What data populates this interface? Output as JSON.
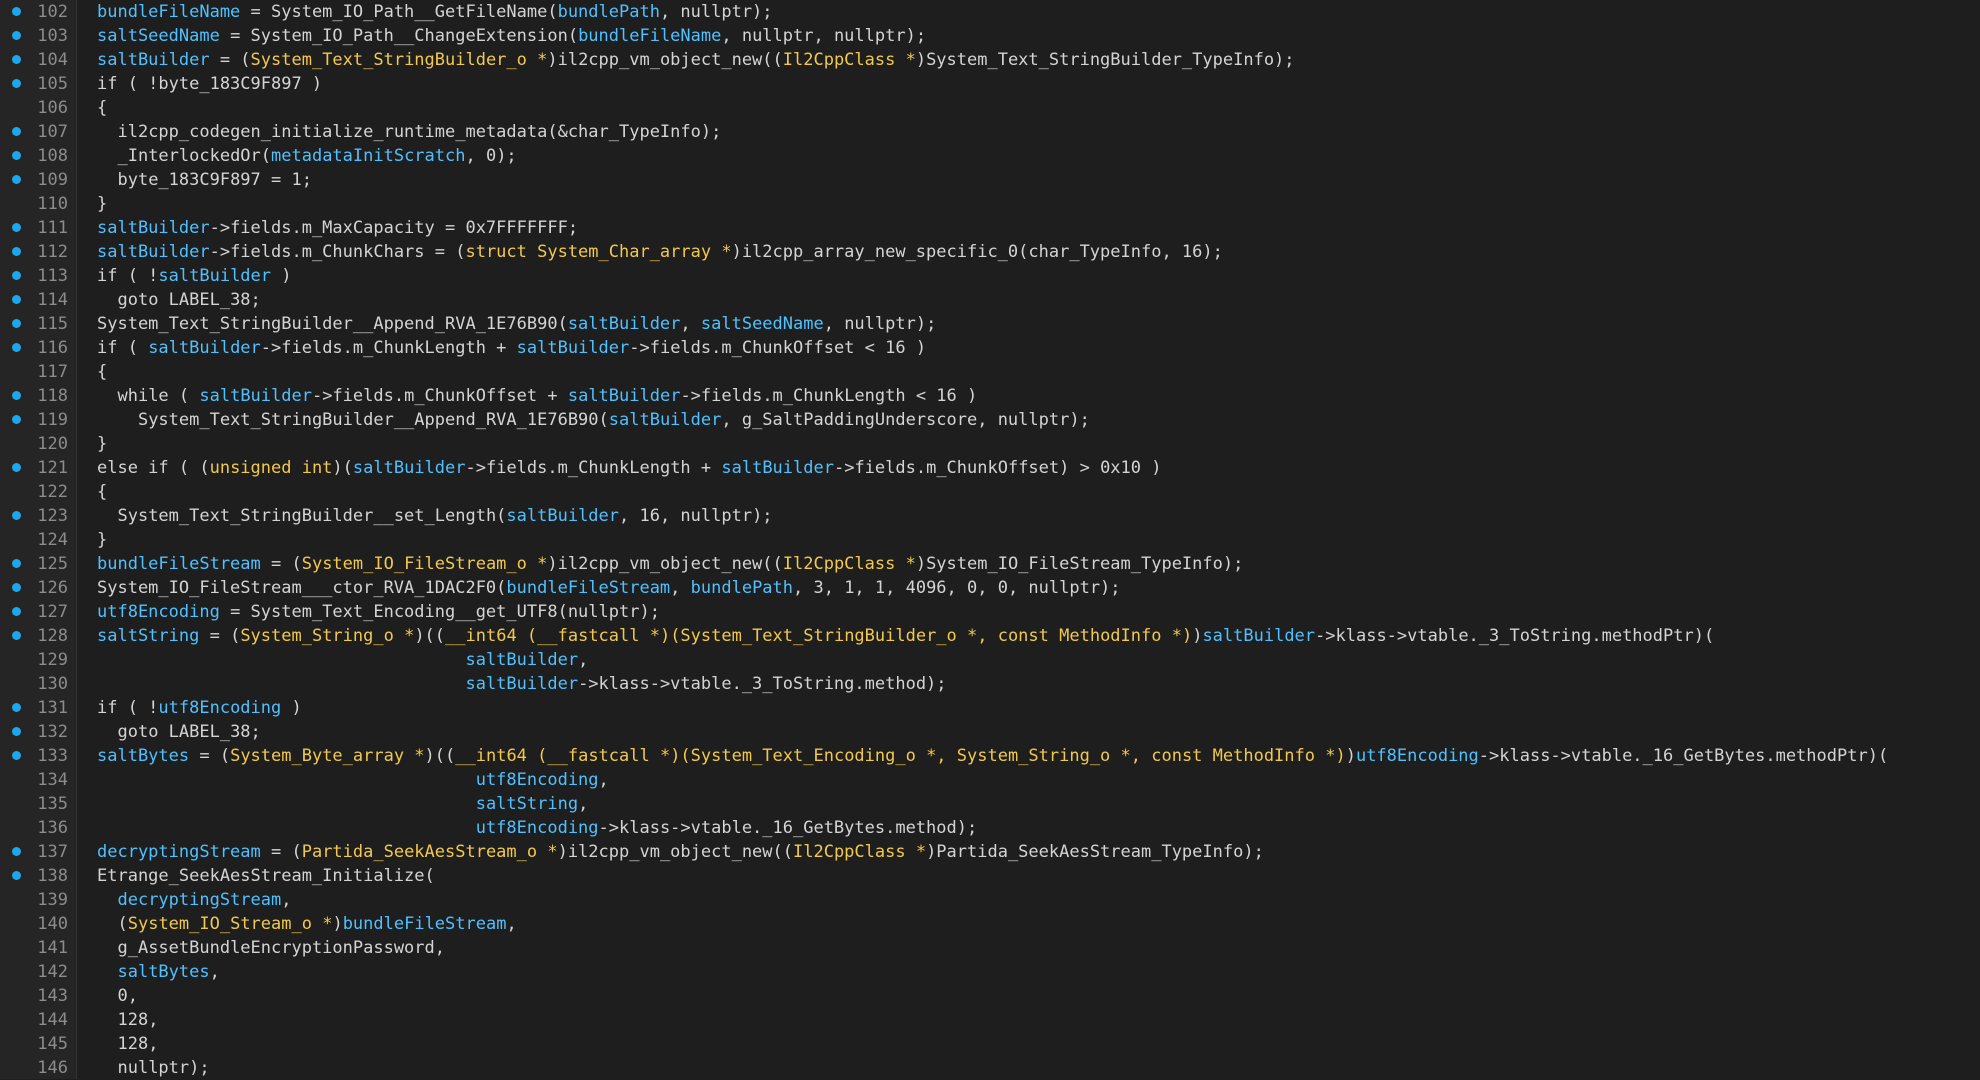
{
  "editor": {
    "colors": {
      "background": "#1e1e1e",
      "gutter": "#252526",
      "line_number": "#8c8c8c",
      "breakpoint": "#1ca7ec",
      "variable": "#4fc1ff",
      "type": "#f2c94c",
      "text": "#d4d4d4"
    },
    "lines": [
      {
        "num": "102",
        "bp": true,
        "indent": 0,
        "tokens": [
          {
            "t": "bundleFileName",
            "c": "var"
          },
          {
            "t": " = System_IO_Path__GetFileName(",
            "c": "plain"
          },
          {
            "t": "bundlePath",
            "c": "var"
          },
          {
            "t": ", nullptr);",
            "c": "plain"
          }
        ]
      },
      {
        "num": "103",
        "bp": true,
        "indent": 0,
        "tokens": [
          {
            "t": "saltSeedName",
            "c": "var"
          },
          {
            "t": " = System_IO_Path__ChangeExtension(",
            "c": "plain"
          },
          {
            "t": "bundleFileName",
            "c": "var"
          },
          {
            "t": ", nullptr, nullptr);",
            "c": "plain"
          }
        ]
      },
      {
        "num": "104",
        "bp": true,
        "indent": 0,
        "tokens": [
          {
            "t": "saltBuilder",
            "c": "var"
          },
          {
            "t": " = (",
            "c": "plain"
          },
          {
            "t": "System_Text_StringBuilder_o *",
            "c": "type"
          },
          {
            "t": ")il2cpp_vm_object_new((",
            "c": "plain"
          },
          {
            "t": "Il2CppClass *",
            "c": "type"
          },
          {
            "t": ")System_Text_StringBuilder_TypeInfo);",
            "c": "plain"
          }
        ]
      },
      {
        "num": "105",
        "bp": true,
        "indent": 0,
        "tokens": [
          {
            "t": "if ( !byte_183C9F897 )",
            "c": "plain"
          }
        ]
      },
      {
        "num": "106",
        "bp": false,
        "indent": 0,
        "tokens": [
          {
            "t": "{",
            "c": "plain"
          }
        ]
      },
      {
        "num": "107",
        "bp": true,
        "indent": 1,
        "tokens": [
          {
            "t": "il2cpp_codegen_initialize_runtime_metadata(&char_TypeInfo);",
            "c": "plain"
          }
        ]
      },
      {
        "num": "108",
        "bp": true,
        "indent": 1,
        "tokens": [
          {
            "t": "_InterlockedOr(",
            "c": "plain"
          },
          {
            "t": "metadataInitScratch",
            "c": "var"
          },
          {
            "t": ", 0);",
            "c": "plain"
          }
        ]
      },
      {
        "num": "109",
        "bp": true,
        "indent": 1,
        "tokens": [
          {
            "t": "byte_183C9F897 = 1;",
            "c": "plain"
          }
        ]
      },
      {
        "num": "110",
        "bp": false,
        "indent": 0,
        "tokens": [
          {
            "t": "}",
            "c": "plain"
          }
        ]
      },
      {
        "num": "111",
        "bp": true,
        "indent": 0,
        "tokens": [
          {
            "t": "saltBuilder",
            "c": "var"
          },
          {
            "t": "->fields.m_MaxCapacity = 0x7FFFFFFF;",
            "c": "plain"
          }
        ]
      },
      {
        "num": "112",
        "bp": true,
        "indent": 0,
        "tokens": [
          {
            "t": "saltBuilder",
            "c": "var"
          },
          {
            "t": "->fields.m_ChunkChars = (",
            "c": "plain"
          },
          {
            "t": "struct System_Char_array *",
            "c": "type"
          },
          {
            "t": ")il2cpp_array_new_specific_0(char_TypeInfo, 16);",
            "c": "plain"
          }
        ]
      },
      {
        "num": "113",
        "bp": true,
        "indent": 0,
        "tokens": [
          {
            "t": "if ( !",
            "c": "plain"
          },
          {
            "t": "saltBuilder",
            "c": "var"
          },
          {
            "t": " )",
            "c": "plain"
          }
        ]
      },
      {
        "num": "114",
        "bp": true,
        "indent": 1,
        "tokens": [
          {
            "t": "goto LABEL_38;",
            "c": "plain"
          }
        ]
      },
      {
        "num": "115",
        "bp": true,
        "indent": 0,
        "tokens": [
          {
            "t": "System_Text_StringBuilder__Append_RVA_1E76B90(",
            "c": "plain"
          },
          {
            "t": "saltBuilder",
            "c": "var"
          },
          {
            "t": ", ",
            "c": "plain"
          },
          {
            "t": "saltSeedName",
            "c": "var"
          },
          {
            "t": ", nullptr);",
            "c": "plain"
          }
        ]
      },
      {
        "num": "116",
        "bp": true,
        "indent": 0,
        "tokens": [
          {
            "t": "if ( ",
            "c": "plain"
          },
          {
            "t": "saltBuilder",
            "c": "var"
          },
          {
            "t": "->fields.m_ChunkLength + ",
            "c": "plain"
          },
          {
            "t": "saltBuilder",
            "c": "var"
          },
          {
            "t": "->fields.m_ChunkOffset < 16 )",
            "c": "plain"
          }
        ]
      },
      {
        "num": "117",
        "bp": false,
        "indent": 0,
        "tokens": [
          {
            "t": "{",
            "c": "plain"
          }
        ]
      },
      {
        "num": "118",
        "bp": true,
        "indent": 1,
        "tokens": [
          {
            "t": "while ( ",
            "c": "plain"
          },
          {
            "t": "saltBuilder",
            "c": "var"
          },
          {
            "t": "->fields.m_ChunkOffset + ",
            "c": "plain"
          },
          {
            "t": "saltBuilder",
            "c": "var"
          },
          {
            "t": "->fields.m_ChunkLength < 16 )",
            "c": "plain"
          }
        ]
      },
      {
        "num": "119",
        "bp": true,
        "indent": 2,
        "tokens": [
          {
            "t": "System_Text_StringBuilder__Append_RVA_1E76B90(",
            "c": "plain"
          },
          {
            "t": "saltBuilder",
            "c": "var"
          },
          {
            "t": ", g_SaltPaddingUnderscore, nullptr);",
            "c": "plain"
          }
        ]
      },
      {
        "num": "120",
        "bp": false,
        "indent": 0,
        "tokens": [
          {
            "t": "}",
            "c": "plain"
          }
        ]
      },
      {
        "num": "121",
        "bp": true,
        "indent": 0,
        "tokens": [
          {
            "t": "else if ( (",
            "c": "plain"
          },
          {
            "t": "unsigned int",
            "c": "type"
          },
          {
            "t": ")(",
            "c": "plain"
          },
          {
            "t": "saltBuilder",
            "c": "var"
          },
          {
            "t": "->fields.m_ChunkLength + ",
            "c": "plain"
          },
          {
            "t": "saltBuilder",
            "c": "var"
          },
          {
            "t": "->fields.m_ChunkOffset) > 0x10 )",
            "c": "plain"
          }
        ]
      },
      {
        "num": "122",
        "bp": false,
        "indent": 0,
        "tokens": [
          {
            "t": "{",
            "c": "plain"
          }
        ]
      },
      {
        "num": "123",
        "bp": true,
        "indent": 1,
        "tokens": [
          {
            "t": "System_Text_StringBuilder__set_Length(",
            "c": "plain"
          },
          {
            "t": "saltBuilder",
            "c": "var"
          },
          {
            "t": ", 16, nullptr);",
            "c": "plain"
          }
        ]
      },
      {
        "num": "124",
        "bp": false,
        "indent": 0,
        "tokens": [
          {
            "t": "}",
            "c": "plain"
          }
        ]
      },
      {
        "num": "125",
        "bp": true,
        "indent": 0,
        "tokens": [
          {
            "t": "bundleFileStream",
            "c": "var"
          },
          {
            "t": " = (",
            "c": "plain"
          },
          {
            "t": "System_IO_FileStream_o *",
            "c": "type"
          },
          {
            "t": ")il2cpp_vm_object_new((",
            "c": "plain"
          },
          {
            "t": "Il2CppClass *",
            "c": "type"
          },
          {
            "t": ")System_IO_FileStream_TypeInfo);",
            "c": "plain"
          }
        ]
      },
      {
        "num": "126",
        "bp": true,
        "indent": 0,
        "tokens": [
          {
            "t": "System_IO_FileStream___ctor_RVA_1DAC2F0(",
            "c": "plain"
          },
          {
            "t": "bundleFileStream",
            "c": "var"
          },
          {
            "t": ", ",
            "c": "plain"
          },
          {
            "t": "bundlePath",
            "c": "var"
          },
          {
            "t": ", 3, 1, 1, 4096, 0, 0, nullptr);",
            "c": "plain"
          }
        ]
      },
      {
        "num": "127",
        "bp": true,
        "indent": 0,
        "tokens": [
          {
            "t": "utf8Encoding",
            "c": "var"
          },
          {
            "t": " = System_Text_Encoding__get_UTF8(nullptr);",
            "c": "plain"
          }
        ]
      },
      {
        "num": "128",
        "bp": true,
        "indent": 0,
        "tokens": [
          {
            "t": "saltString",
            "c": "var"
          },
          {
            "t": " = (",
            "c": "plain"
          },
          {
            "t": "System_String_o *",
            "c": "type"
          },
          {
            "t": ")((",
            "c": "plain"
          },
          {
            "t": "__int64 (__fastcall *)(System_Text_StringBuilder_o *, const MethodInfo *)",
            "c": "type"
          },
          {
            "t": ")",
            "c": "plain"
          },
          {
            "t": "saltBuilder",
            "c": "var"
          },
          {
            "t": "->klass->vtable._3_ToString.methodPtr)(",
            "c": "plain"
          }
        ]
      },
      {
        "num": "129",
        "bp": false,
        "indent": 0,
        "pad": "                                    ",
        "tokens": [
          {
            "t": "saltBuilder",
            "c": "var"
          },
          {
            "t": ",",
            "c": "plain"
          }
        ]
      },
      {
        "num": "130",
        "bp": false,
        "indent": 0,
        "pad": "                                    ",
        "tokens": [
          {
            "t": "saltBuilder",
            "c": "var"
          },
          {
            "t": "->klass->vtable._3_ToString.method);",
            "c": "plain"
          }
        ]
      },
      {
        "num": "131",
        "bp": true,
        "indent": 0,
        "tokens": [
          {
            "t": "if ( !",
            "c": "plain"
          },
          {
            "t": "utf8Encoding",
            "c": "var"
          },
          {
            "t": " )",
            "c": "plain"
          }
        ]
      },
      {
        "num": "132",
        "bp": true,
        "indent": 1,
        "tokens": [
          {
            "t": "goto LABEL_38;",
            "c": "plain"
          }
        ]
      },
      {
        "num": "133",
        "bp": true,
        "indent": 0,
        "tokens": [
          {
            "t": "saltBytes",
            "c": "var"
          },
          {
            "t": " = (",
            "c": "plain"
          },
          {
            "t": "System_Byte_array *",
            "c": "type"
          },
          {
            "t": ")((",
            "c": "plain"
          },
          {
            "t": "__int64 (__fastcall *)(System_Text_Encoding_o *, System_String_o *, const MethodInfo *)",
            "c": "type"
          },
          {
            "t": ")",
            "c": "plain"
          },
          {
            "t": "utf8Encoding",
            "c": "var"
          },
          {
            "t": "->klass->vtable._16_GetBytes.methodPtr)(",
            "c": "plain"
          }
        ]
      },
      {
        "num": "134",
        "bp": false,
        "indent": 0,
        "pad": "                                     ",
        "tokens": [
          {
            "t": "utf8Encoding",
            "c": "var"
          },
          {
            "t": ",",
            "c": "plain"
          }
        ]
      },
      {
        "num": "135",
        "bp": false,
        "indent": 0,
        "pad": "                                     ",
        "tokens": [
          {
            "t": "saltString",
            "c": "var"
          },
          {
            "t": ",",
            "c": "plain"
          }
        ]
      },
      {
        "num": "136",
        "bp": false,
        "indent": 0,
        "pad": "                                     ",
        "tokens": [
          {
            "t": "utf8Encoding",
            "c": "var"
          },
          {
            "t": "->klass->vtable._16_GetBytes.method);",
            "c": "plain"
          }
        ]
      },
      {
        "num": "137",
        "bp": true,
        "indent": 0,
        "tokens": [
          {
            "t": "decryptingStream",
            "c": "var"
          },
          {
            "t": " = (",
            "c": "plain"
          },
          {
            "t": "Partida_SeekAesStream_o *",
            "c": "type"
          },
          {
            "t": ")il2cpp_vm_object_new((",
            "c": "plain"
          },
          {
            "t": "Il2CppClass *",
            "c": "type"
          },
          {
            "t": ")Partida_SeekAesStream_TypeInfo);",
            "c": "plain"
          }
        ]
      },
      {
        "num": "138",
        "bp": true,
        "indent": 0,
        "tokens": [
          {
            "t": "Etrange_SeekAesStream_Initialize(",
            "c": "plain"
          }
        ]
      },
      {
        "num": "139",
        "bp": false,
        "indent": 1,
        "tokens": [
          {
            "t": "decryptingStream",
            "c": "var"
          },
          {
            "t": ",",
            "c": "plain"
          }
        ]
      },
      {
        "num": "140",
        "bp": false,
        "indent": 1,
        "tokens": [
          {
            "t": "(",
            "c": "plain"
          },
          {
            "t": "System_IO_Stream_o *",
            "c": "type"
          },
          {
            "t": ")",
            "c": "plain"
          },
          {
            "t": "bundleFileStream",
            "c": "var"
          },
          {
            "t": ",",
            "c": "plain"
          }
        ]
      },
      {
        "num": "141",
        "bp": false,
        "indent": 1,
        "tokens": [
          {
            "t": "g_AssetBundleEncryptionPassword,",
            "c": "plain"
          }
        ]
      },
      {
        "num": "142",
        "bp": false,
        "indent": 1,
        "tokens": [
          {
            "t": "saltBytes",
            "c": "var"
          },
          {
            "t": ",",
            "c": "plain"
          }
        ]
      },
      {
        "num": "143",
        "bp": false,
        "indent": 1,
        "tokens": [
          {
            "t": "0,",
            "c": "plain"
          }
        ]
      },
      {
        "num": "144",
        "bp": false,
        "indent": 1,
        "tokens": [
          {
            "t": "128,",
            "c": "plain"
          }
        ]
      },
      {
        "num": "145",
        "bp": false,
        "indent": 1,
        "tokens": [
          {
            "t": "128,",
            "c": "plain"
          }
        ]
      },
      {
        "num": "146",
        "bp": false,
        "indent": 1,
        "tokens": [
          {
            "t": "nullptr);",
            "c": "plain"
          }
        ]
      }
    ]
  }
}
